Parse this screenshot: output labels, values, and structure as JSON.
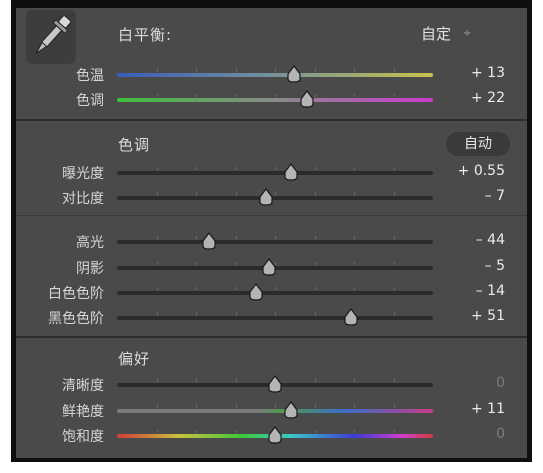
{
  "white_balance": {
    "title": "白平衡:",
    "mode": "自定",
    "mode_arrows": "÷",
    "sliders": [
      {
        "label": "色温",
        "value": "+ 13",
        "level": 0.56
      },
      {
        "label": "色调",
        "value": "+ 22",
        "level": 0.6
      }
    ]
  },
  "tone": {
    "title": "色调",
    "auto_label": "自动",
    "sliders": [
      {
        "label": "曝光度",
        "value": "+ 0.55",
        "level": 0.55
      },
      {
        "label": "对比度",
        "value": "– 7",
        "level": 0.47
      }
    ],
    "detail_sliders": [
      {
        "label": "高光",
        "value": "– 44",
        "level": 0.29
      },
      {
        "label": "阴影",
        "value": "– 5",
        "level": 0.48
      },
      {
        "label": "白色色阶",
        "value": "– 14",
        "level": 0.44
      },
      {
        "label": "黑色色阶",
        "value": "+ 51",
        "level": 0.74
      }
    ]
  },
  "presence": {
    "title": "偏好",
    "sliders": [
      {
        "label": "清晰度",
        "value": "0",
        "level": 0.5
      },
      {
        "label": "鲜艳度",
        "value": "+ 11",
        "level": 0.55
      },
      {
        "label": "饱和度",
        "value": "0",
        "level": 0.5
      }
    ]
  },
  "colors": {
    "panel": "#4a4a4a",
    "frame": "#0f0f0f",
    "thumb": "#b4b4b4"
  },
  "icons": [
    "eyedropper-icon",
    "updown-arrows-icon",
    "slider-thumb-icon"
  ]
}
